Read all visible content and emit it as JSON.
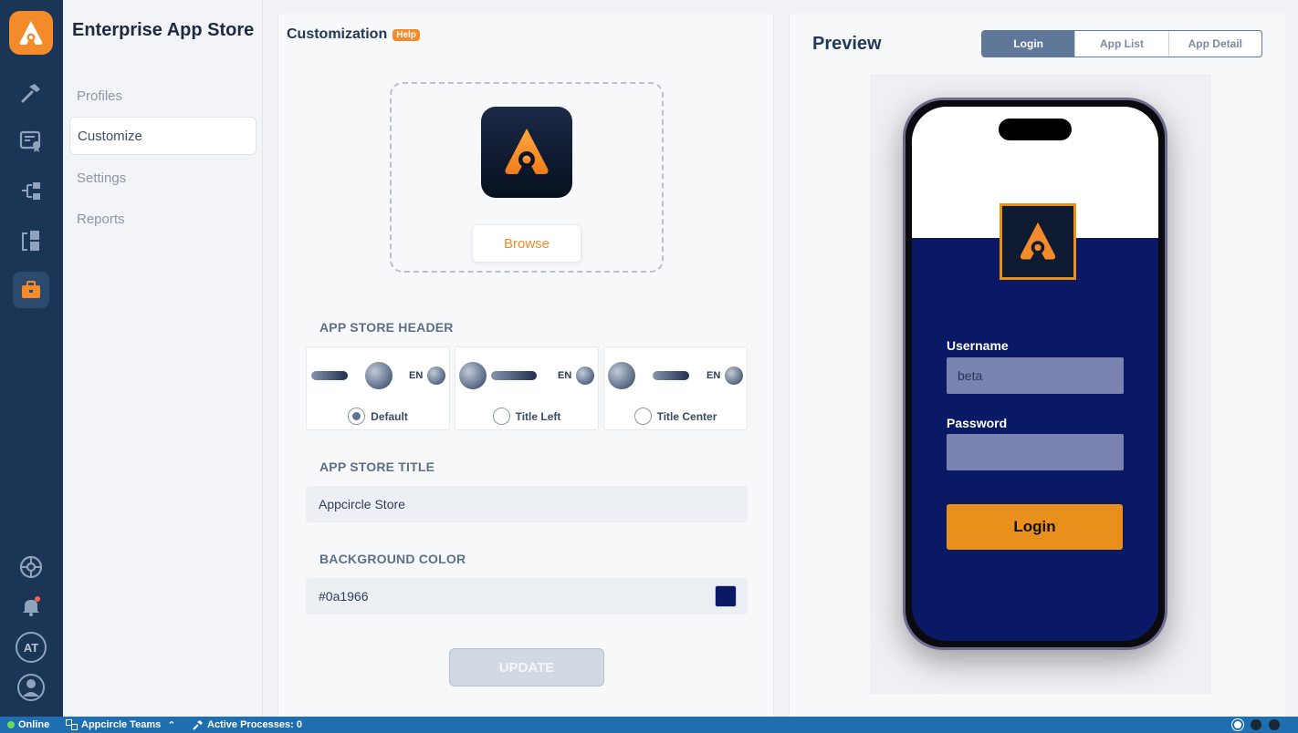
{
  "app": {
    "section_title": "Enterprise App Store"
  },
  "subnav": {
    "items": [
      {
        "label": "Profiles",
        "active": false
      },
      {
        "label": "Customize",
        "active": true
      },
      {
        "label": "Settings",
        "active": false
      },
      {
        "label": "Reports",
        "active": false
      }
    ]
  },
  "rail": {
    "icons": [
      "appcircle-logo-icon",
      "hammer-icon",
      "certificate-icon",
      "distribution-icon",
      "testing-icon",
      "briefcase-icon",
      "settings-wheel-icon",
      "notification-bell-icon"
    ],
    "avatar_initials": "AT",
    "accent_color": "#f48b2a"
  },
  "customization": {
    "title": "Customization",
    "help_badge": "Help",
    "browse_label": "Browse",
    "header_section_label": "APP STORE HEADER",
    "header_options": [
      {
        "label": "Default",
        "selected": true,
        "en": "EN"
      },
      {
        "label": "Title Left",
        "selected": false,
        "en": "EN"
      },
      {
        "label": "Title Center",
        "selected": false,
        "en": "EN"
      }
    ],
    "title_section_label": "APP STORE TITLE",
    "title_value": "Appcircle Store",
    "bg_section_label": "BACKGROUND COLOR",
    "bg_value": "#0a1966",
    "update_label": "UPDATE"
  },
  "preview": {
    "title": "Preview",
    "tabs": [
      {
        "label": "Login",
        "active": true
      },
      {
        "label": "App List",
        "active": false
      },
      {
        "label": "App Detail",
        "active": false
      }
    ],
    "username_label": "Username",
    "username_value": "beta",
    "password_label": "Password",
    "password_value": "",
    "login_button": "Login",
    "login_button_color": "#e8901b"
  },
  "status_bar": {
    "online": "Online",
    "team": "Appcircle Teams",
    "processes": "Active Processes: 0"
  }
}
